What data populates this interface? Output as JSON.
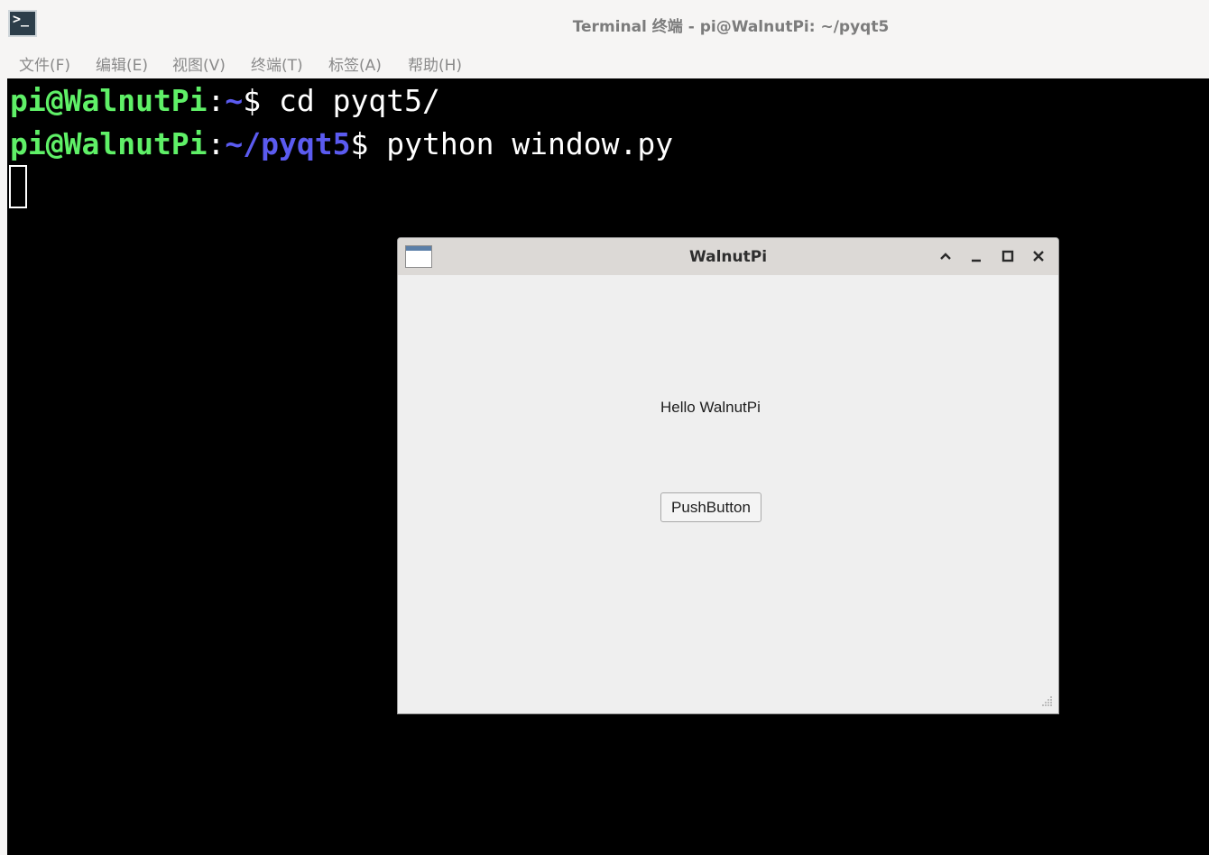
{
  "terminal": {
    "app_icon_glyph": ">_",
    "title": "Terminal 终端 - pi@WalnutPi: ~/pyqt5",
    "menu": [
      {
        "label": "文件(F)"
      },
      {
        "label": "编辑(E)"
      },
      {
        "label": "视图(V)"
      },
      {
        "label": "终端(T)"
      },
      {
        "label": "标签(A)"
      },
      {
        "label": "帮助(H)"
      }
    ],
    "lines": [
      {
        "user_host": "pi@WalnutPi",
        "colon": ":",
        "path": "~",
        "symbol": "$",
        "command": " cd pyqt5/"
      },
      {
        "user_host": "pi@WalnutPi",
        "colon": ":",
        "path": "~/pyqt5",
        "symbol": "$",
        "command": " python window.py"
      }
    ],
    "colors": {
      "prompt_user": "#5ff067",
      "prompt_path": "#5b5bf0",
      "background": "#000000",
      "text": "#ffffff"
    }
  },
  "qt_window": {
    "title": "WalnutPi",
    "controls": [
      "chevron-up-icon",
      "minimize-icon",
      "maximize-icon",
      "close-icon"
    ],
    "label": "Hello WalnutPi",
    "button_label": "PushButton"
  }
}
